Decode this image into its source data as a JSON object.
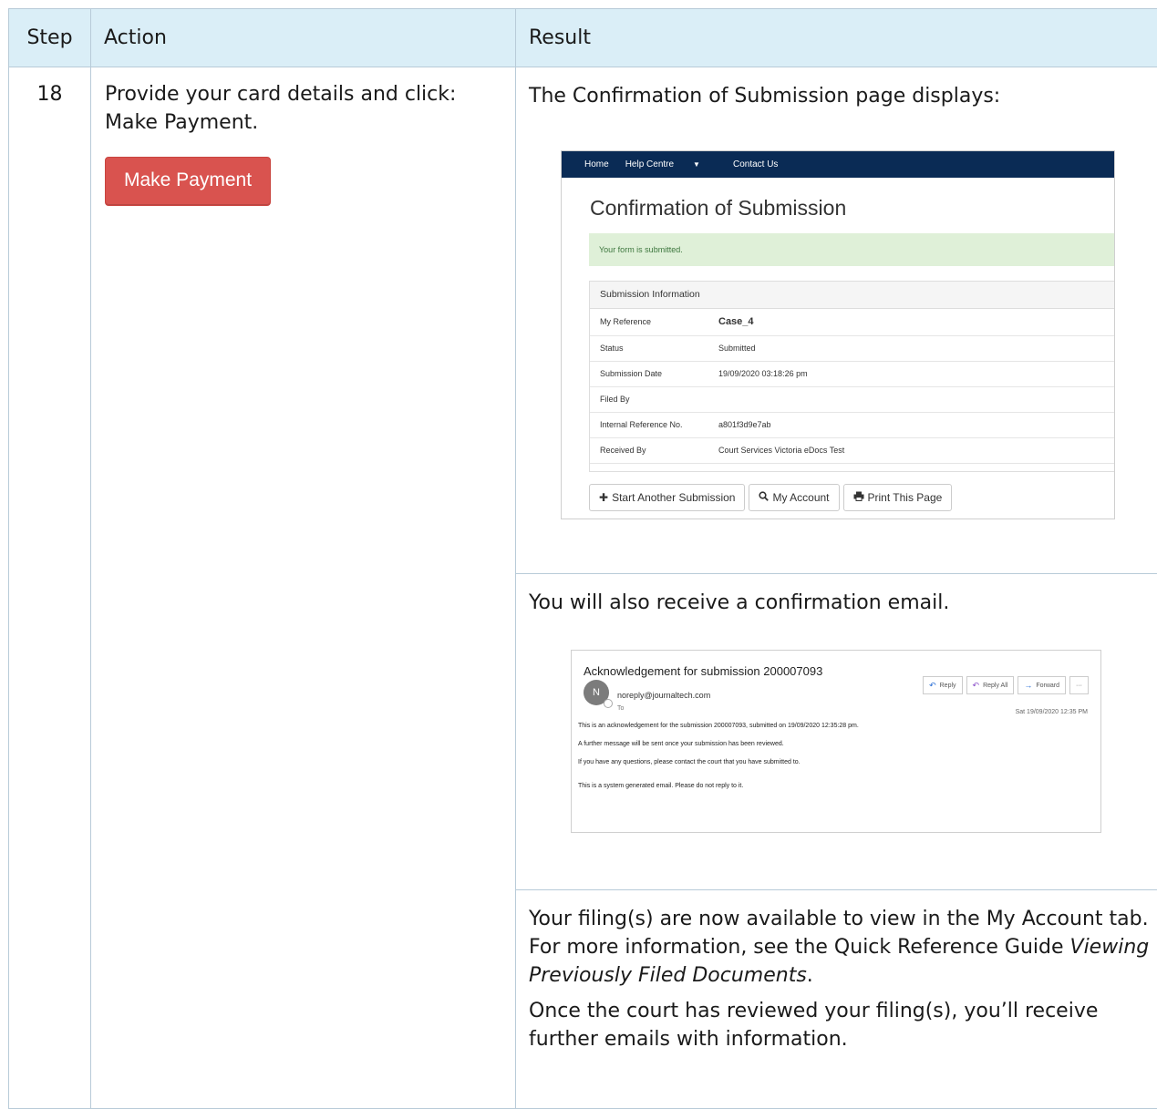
{
  "table": {
    "headers": {
      "step": "Step",
      "action": "Action",
      "result": "Result"
    },
    "step_number": "18",
    "action_text": "Provide your card details and click: Make Payment.",
    "make_payment_button": "Make Payment",
    "result_intro": "The Confirmation of Submission page displays:",
    "email_intro": "You will also receive a confirmation email.",
    "final_para1_pre": "Your filing(s) are now available to view in the My Account tab. For more information, see the Quick Reference Guide ",
    "final_para1_em": "Viewing Previously Filed Documents",
    "final_para1_post": ".",
    "final_para2": "Once the court has reviewed your filing(s), you’ll receive further emails with information."
  },
  "confirmation_page": {
    "nav": {
      "home": "Home",
      "help_centre": "Help Centre",
      "contact_us": "Contact Us"
    },
    "title": "Confirmation of Submission",
    "alert": "Your form is submitted.",
    "panel_heading": "Submission Information",
    "rows": [
      {
        "label": "My Reference",
        "value": "Case_4"
      },
      {
        "label": "Status",
        "value": "Submitted"
      },
      {
        "label": "Submission Date",
        "value": "19/09/2020 03:18:26 pm"
      },
      {
        "label": "Filed By",
        "value": ""
      },
      {
        "label": "Internal Reference No.",
        "value": "a801f3d9e7ab"
      },
      {
        "label": "Received By",
        "value": "Court Services Victoria eDocs Test"
      }
    ],
    "buttons": {
      "start_another": "Start Another Submission",
      "my_account": "My Account",
      "print_page": "Print This Page"
    }
  },
  "email": {
    "subject": "Acknowledgement for submission 200007093",
    "avatar_initial": "N",
    "sender": "noreply@journaltech.com",
    "to": "To",
    "actions": {
      "reply": "Reply",
      "reply_all": "Reply All",
      "forward": "Forward",
      "more": "···"
    },
    "date": "Sat 19/09/2020 12:35 PM",
    "body": [
      "This is an acknowledgement for the submission 200007093, submitted on 19/09/2020 12:35:28 pm.",
      "A further message will be sent once your submission has been reviewed.",
      "If you have any questions, please contact the court that you have submitted to.",
      "This is a system generated email. Please do not reply to it."
    ]
  },
  "colors": {
    "header_bg": "#daeef7",
    "border": "#b8cbd8",
    "make_payment_bg": "#d9534f",
    "navbar_bg": "#0a2b55",
    "alert_bg": "#dff0d8"
  }
}
